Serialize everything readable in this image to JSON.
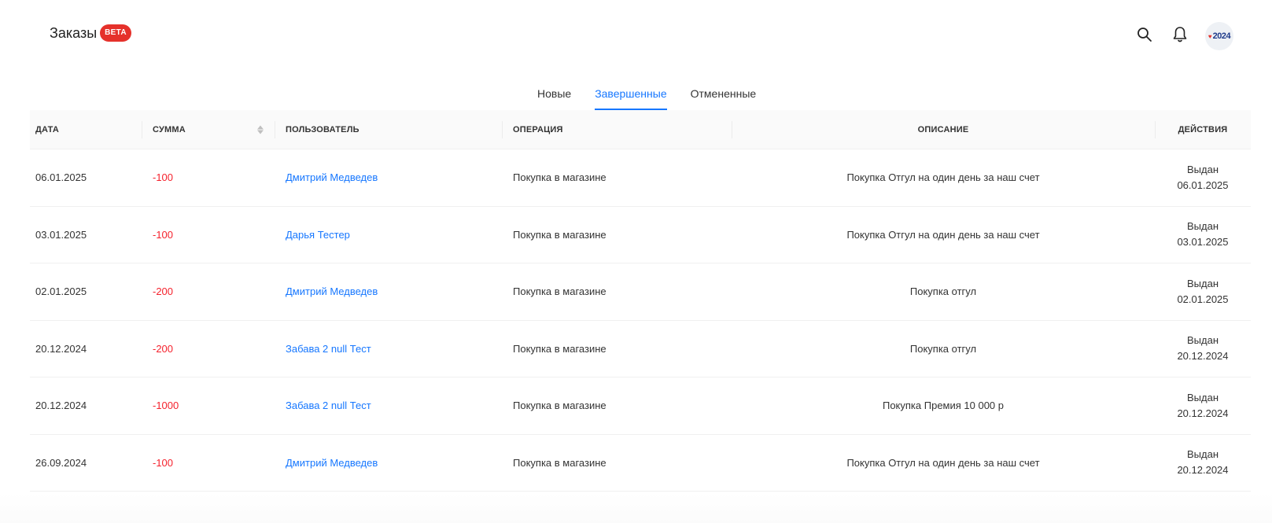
{
  "header": {
    "title": "Заказы",
    "badge": "BETA",
    "avatar_text": "2024"
  },
  "tabs": [
    {
      "label": "Новые",
      "active": false
    },
    {
      "label": "Завершенные",
      "active": true
    },
    {
      "label": "Отмененные",
      "active": false
    }
  ],
  "table": {
    "columns": [
      "Дата",
      "Сумма",
      "Пользователь",
      "Операция",
      "Описание",
      "Действия"
    ],
    "rows": [
      {
        "date": "06.01.2025",
        "amount": "-100",
        "user": "Дмитрий Медведев",
        "operation": "Покупка в магазине",
        "description": "Покупка Отгул на один день за наш счет",
        "action_status": "Выдан",
        "action_date": "06.01.2025"
      },
      {
        "date": "03.01.2025",
        "amount": "-100",
        "user": "Дарья Тестер",
        "operation": "Покупка в магазине",
        "description": "Покупка Отгул на один день за наш счет",
        "action_status": "Выдан",
        "action_date": "03.01.2025"
      },
      {
        "date": "02.01.2025",
        "amount": "-200",
        "user": "Дмитрий Медведев",
        "operation": "Покупка в магазине",
        "description": "Покупка отгул",
        "action_status": "Выдан",
        "action_date": "02.01.2025"
      },
      {
        "date": "20.12.2024",
        "amount": "-200",
        "user": "Забава 2 null Тест",
        "operation": "Покупка в магазине",
        "description": "Покупка отгул",
        "action_status": "Выдан",
        "action_date": "20.12.2024"
      },
      {
        "date": "20.12.2024",
        "amount": "-1000",
        "user": "Забава 2 null Тест",
        "operation": "Покупка в магазине",
        "description": "Покупка Премия 10 000 р",
        "action_status": "Выдан",
        "action_date": "20.12.2024"
      },
      {
        "date": "26.09.2024",
        "amount": "-100",
        "user": "Дмитрий Медведев",
        "operation": "Покупка в магазине",
        "description": "Покупка Отгул на один день за наш счет",
        "action_status": "Выдан",
        "action_date": "20.12.2024"
      }
    ]
  },
  "colors": {
    "accent": "#1677ff",
    "negative": "#f5222d",
    "badge": "#e5312b"
  },
  "icons": {
    "search": "search-icon",
    "notifications": "bell-icon",
    "sort": "sort-icon"
  }
}
